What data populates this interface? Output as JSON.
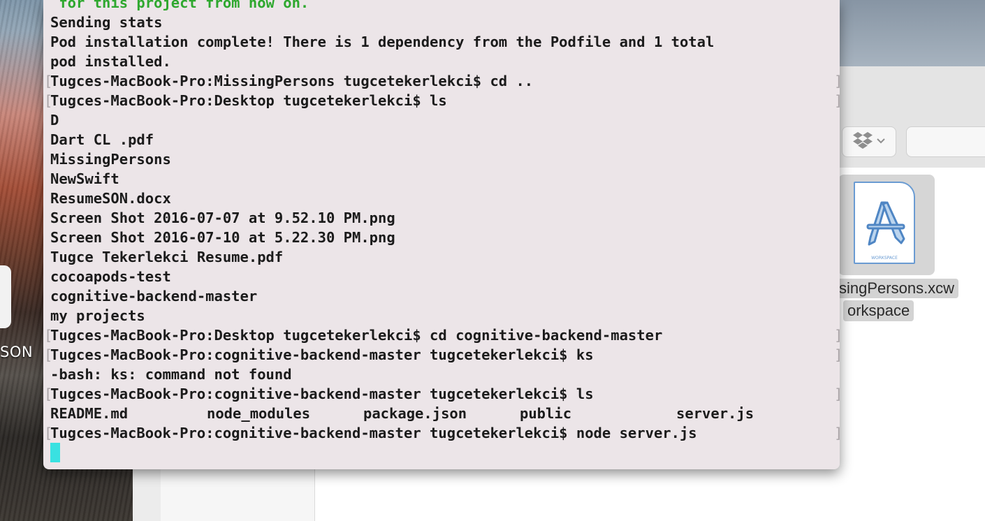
{
  "desktop": {
    "partial_label": "SON"
  },
  "finder": {
    "file_name_line1": "singPersons.xcw",
    "file_name_line2": "orkspace",
    "file_icon_badge": "WORKSPACE",
    "dropbox_icon": "dropbox-icon",
    "dropdown_caret": "⌄"
  },
  "terminal": {
    "lines": [
      {
        "text": " for this project from now on.",
        "style": "green",
        "prompt": false
      },
      {
        "text": "Sending stats",
        "style": "normal",
        "prompt": false
      },
      {
        "text": "Pod installation complete! There is 1 dependency from the Podfile and 1 total",
        "style": "normal",
        "prompt": false
      },
      {
        "text": "pod installed.",
        "style": "normal",
        "prompt": false
      },
      {
        "text": "Tugces-MacBook-Pro:MissingPersons tugcetekerlekci$ cd ..",
        "style": "normal",
        "prompt": true
      },
      {
        "text": "Tugces-MacBook-Pro:Desktop tugcetekerlekci$ ls",
        "style": "normal",
        "prompt": true
      },
      {
        "text": "D",
        "style": "normal",
        "prompt": false
      },
      {
        "text": "Dart CL .pdf",
        "style": "normal",
        "prompt": false
      },
      {
        "text": "MissingPersons",
        "style": "normal",
        "prompt": false
      },
      {
        "text": "NewSwift",
        "style": "normal",
        "prompt": false
      },
      {
        "text": "ResumeSON.docx",
        "style": "normal",
        "prompt": false
      },
      {
        "text": "Screen Shot 2016-07-07 at 9.52.10 PM.png",
        "style": "normal",
        "prompt": false
      },
      {
        "text": "Screen Shot 2016-07-10 at 5.22.30 PM.png",
        "style": "normal",
        "prompt": false
      },
      {
        "text": "Tugce Tekerlekci Resume.pdf",
        "style": "normal",
        "prompt": false
      },
      {
        "text": "cocoapods-test",
        "style": "normal",
        "prompt": false
      },
      {
        "text": "cognitive-backend-master",
        "style": "normal",
        "prompt": false
      },
      {
        "text": "my projects",
        "style": "normal",
        "prompt": false
      },
      {
        "text": "Tugces-MacBook-Pro:Desktop tugcetekerlekci$ cd cognitive-backend-master",
        "style": "normal",
        "prompt": true
      },
      {
        "text": "Tugces-MacBook-Pro:cognitive-backend-master tugcetekerlekci$ ks",
        "style": "normal",
        "prompt": true
      },
      {
        "text": "-bash: ks: command not found",
        "style": "normal",
        "prompt": false
      },
      {
        "text": "Tugces-MacBook-Pro:cognitive-backend-master tugcetekerlekci$ ls",
        "style": "normal",
        "prompt": true
      }
    ],
    "ls_output": [
      "README.md",
      "node_modules",
      "package.json",
      "public",
      "server.js"
    ],
    "last_line": "Tugces-MacBook-Pro:cognitive-backend-master tugcetekerlekci$ node server.js",
    "bracket_left": "[",
    "bracket_right": "]"
  }
}
